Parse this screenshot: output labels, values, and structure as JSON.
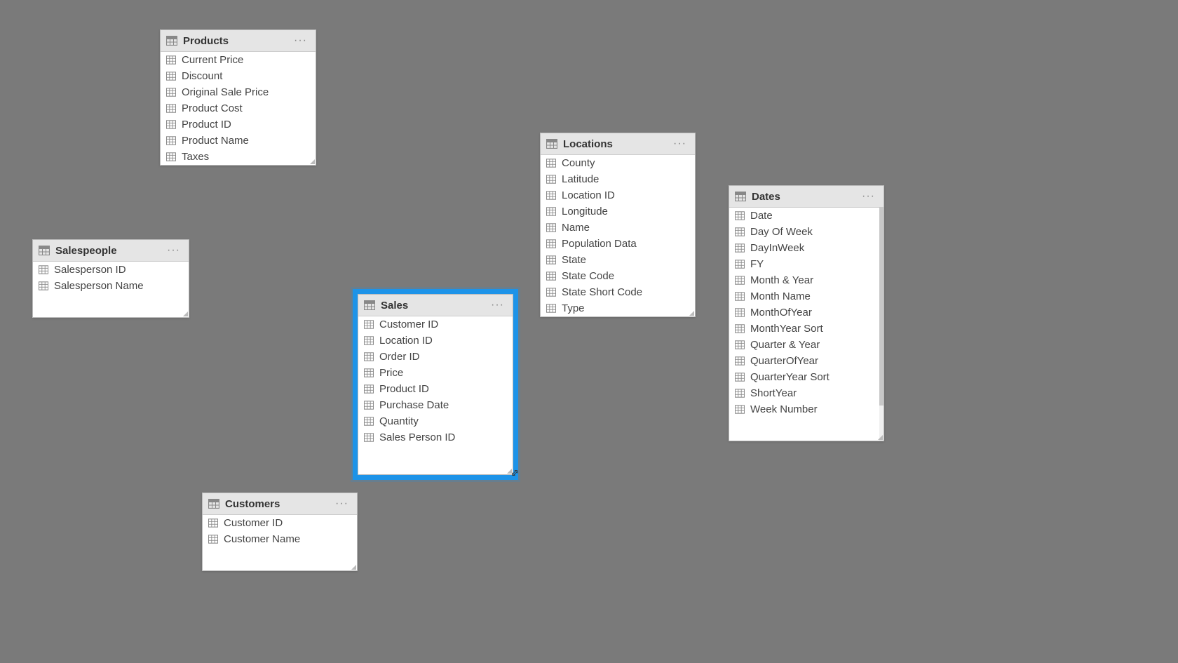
{
  "tables": {
    "products": {
      "title": "Products",
      "fields": [
        "Current Price",
        "Discount",
        "Original Sale Price",
        "Product Cost",
        "Product ID",
        "Product Name",
        "Taxes"
      ]
    },
    "salespeople": {
      "title": "Salespeople",
      "fields": [
        "Salesperson ID",
        "Salesperson Name"
      ]
    },
    "sales": {
      "title": "Sales",
      "fields": [
        "Customer ID",
        "Location ID",
        "Order ID",
        "Price",
        "Product ID",
        "Purchase Date",
        "Quantity",
        "Sales Person ID"
      ]
    },
    "locations": {
      "title": "Locations",
      "fields": [
        "County",
        "Latitude",
        "Location ID",
        "Longitude",
        "Name",
        "Population Data",
        "State",
        "State Code",
        "State Short Code",
        "Type"
      ]
    },
    "dates": {
      "title": "Dates",
      "fields": [
        "Date",
        "Day Of Week",
        "DayInWeek",
        "FY",
        "Month & Year",
        "Month Name",
        "MonthOfYear",
        "MonthYear Sort",
        "Quarter & Year",
        "QuarterOfYear",
        "QuarterYear Sort",
        "ShortYear",
        "Week Number"
      ]
    },
    "customers": {
      "title": "Customers",
      "fields": [
        "Customer ID",
        "Customer Name"
      ]
    }
  },
  "more_label": "···"
}
